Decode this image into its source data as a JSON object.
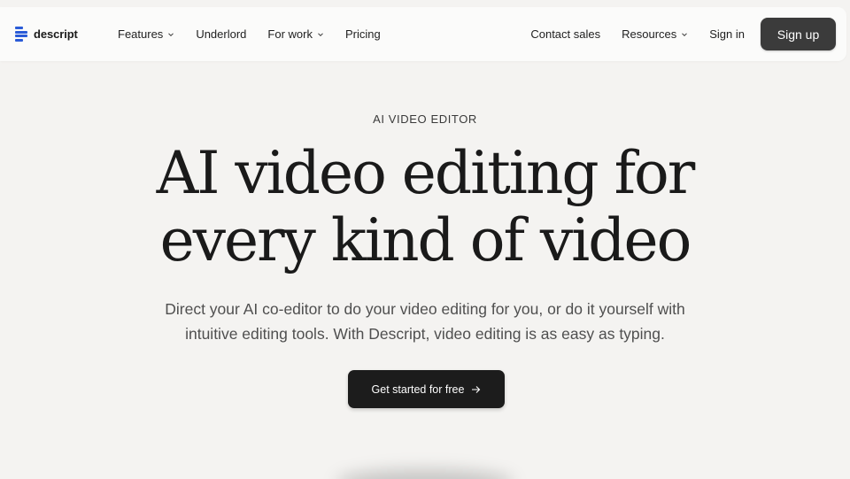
{
  "nav": {
    "logo_text": "descript",
    "left_items": [
      {
        "label": "Features",
        "has_dropdown": true
      },
      {
        "label": "Underlord",
        "has_dropdown": false
      },
      {
        "label": "For work",
        "has_dropdown": true
      },
      {
        "label": "Pricing",
        "has_dropdown": false
      }
    ],
    "right_items": {
      "contact": "Contact sales",
      "resources": "Resources",
      "sign_in": "Sign in",
      "sign_up": "Sign up"
    }
  },
  "hero": {
    "eyebrow": "AI VIDEO EDITOR",
    "headline_line1": "AI video editing for",
    "headline_line2": "every kind of video",
    "subhead_line1": "Direct your AI co-editor to do your video editing for you, or do it yourself with",
    "subhead_line2": "intuitive editing tools. With Descript, video editing is as easy as typing.",
    "cta_label": "Get started for free",
    "cta_icon": "arrow-right-icon"
  },
  "colors": {
    "background": "#f4f3f1",
    "nav_bg": "#fbfbfa",
    "logo_accent": "#2a5bd7",
    "signup_bg": "#3b3b3b",
    "cta_bg": "#1c1c1c"
  }
}
